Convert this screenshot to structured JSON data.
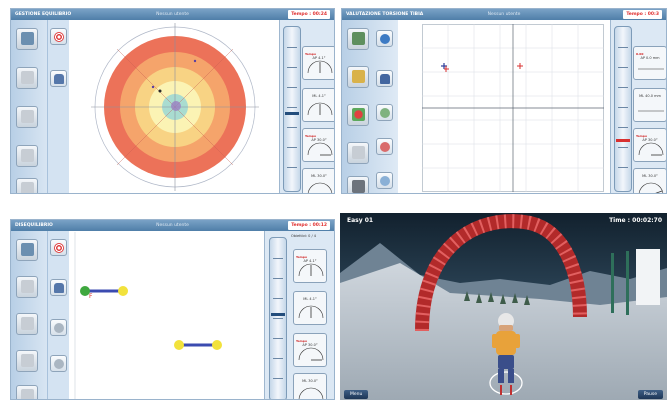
{
  "panel1": {
    "title": "GESTIONE EQUILIBRIO",
    "center_text": "Nessun utente",
    "timer_label": "Tempo :",
    "timer_value": "00:24",
    "gauges": [
      {
        "label": "AP 4.1°",
        "sub": "Tempo"
      },
      {
        "label": "ML 4.1°",
        "sub": ""
      },
      {
        "label": "AP 30.0°",
        "sub": "Tempo"
      },
      {
        "label": "ML 30.0°",
        "sub": ""
      }
    ]
  },
  "panel2": {
    "title": "VALUTAZIONE TORSIONE TIBIA",
    "center_text": "Nessun utente",
    "timer_label": "Tempo :",
    "timer_value": "00:3",
    "gauges": [
      {
        "label": "AP 0.0 mm",
        "sub": "0.00"
      },
      {
        "label": "ML 40.0 mm",
        "sub": ""
      },
      {
        "label": "AP 30.0°",
        "sub": "Tempo"
      },
      {
        "label": "ML 30.0°",
        "sub": ""
      }
    ]
  },
  "panel3": {
    "title": "DISEQUILIBRIO",
    "center_text": "Nessun utente",
    "timer_label": "Tempo :",
    "timer_value": "00:12",
    "count_label": "Obiettivi:",
    "count_value": "0 / 4",
    "gauges": [
      {
        "label": "AP 4.1°",
        "sub": "Tempo"
      },
      {
        "label": "ML 4.1°",
        "sub": ""
      },
      {
        "label": "AP 30.0°",
        "sub": "Tempo"
      },
      {
        "label": "ML 30.0°",
        "sub": ""
      }
    ]
  },
  "game": {
    "level": "Easy 01",
    "time_label": "Time : 00:02:70",
    "menu_button": "Menu",
    "pause_button": "Pause"
  },
  "colors": {
    "titlebar": "#4f7ea8",
    "ring_outer": "#ec7259",
    "ring2": "#f5a46b",
    "ring3": "#f8d384",
    "ring4": "#fbf3b4",
    "ring5": "#a9dcd0",
    "timer_red": "#e03030"
  }
}
